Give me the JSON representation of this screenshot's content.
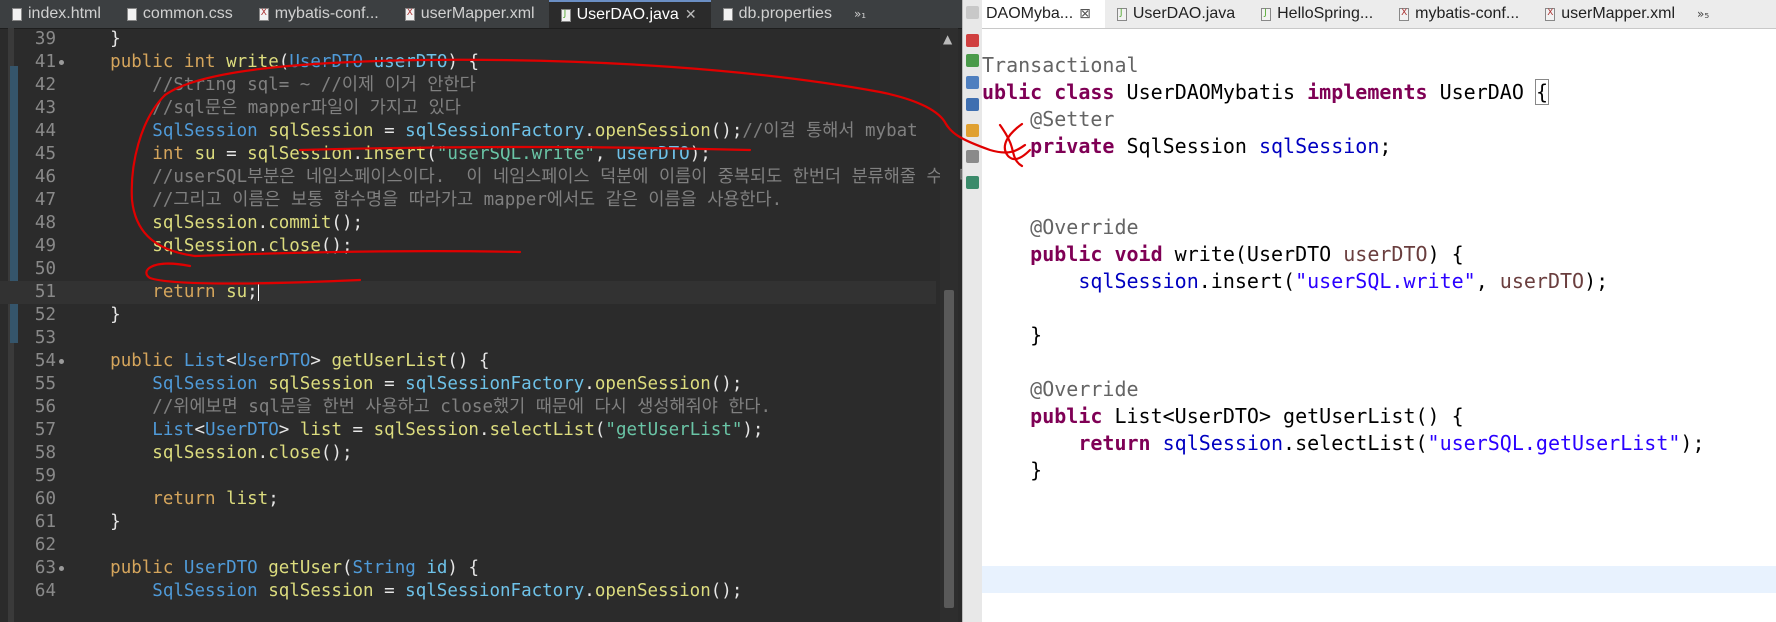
{
  "left_pane": {
    "tabs": [
      {
        "label": "index.html",
        "icon": "html-file-icon",
        "active": false
      },
      {
        "label": "common.css",
        "icon": "css-file-icon",
        "active": false
      },
      {
        "label": "mybatis-conf...",
        "icon": "xml-file-icon",
        "active": false
      },
      {
        "label": "userMapper.xml",
        "icon": "xml-file-icon",
        "active": false
      },
      {
        "label": "UserDAO.java",
        "icon": "java-file-icon",
        "active": true
      },
      {
        "label": "db.properties",
        "icon": "properties-file-icon",
        "active": false
      }
    ],
    "more_tabs": "»₁",
    "code_lines": [
      {
        "n": "39",
        "t": "    }"
      },
      {
        "n": "41",
        "t": "    public int write(UserDTO userDTO) {"
      },
      {
        "n": "42",
        "t": "        //String sql= ~ //이제 이거 안한다"
      },
      {
        "n": "43",
        "t": "        //sql문은 mapper파일이 가지고 있다"
      },
      {
        "n": "44",
        "t": "        SqlSession sqlSession = sqlSessionFactory.openSession();//이걸 통해서 mybat"
      },
      {
        "n": "45",
        "t": "        int su = sqlSession.insert(\"userSQL.write\", userDTO);"
      },
      {
        "n": "46",
        "t": "        //userSQL부분은 네임스페이스이다.  이 네임스페이스 덕분에 이름이 중복되도 한번더 분류해줄 수있다."
      },
      {
        "n": "47",
        "t": "        //그리고 이름은 보통 함수명을 따라가고 mapper에서도 같은 이름을 사용한다."
      },
      {
        "n": "48",
        "t": "        sqlSession.commit();"
      },
      {
        "n": "49",
        "t": "        sqlSession.close();"
      },
      {
        "n": "50",
        "t": ""
      },
      {
        "n": "51",
        "t": "        return su;"
      },
      {
        "n": "52",
        "t": "    }"
      },
      {
        "n": "53",
        "t": ""
      },
      {
        "n": "54",
        "t": "    public List<UserDTO> getUserList() {"
      },
      {
        "n": "55",
        "t": "        SqlSession sqlSession = sqlSessionFactory.openSession();"
      },
      {
        "n": "56",
        "t": "        //위에보면 sql문을 한번 사용하고 close했기 때문에 다시 생성해줘야 한다."
      },
      {
        "n": "57",
        "t": "        List<UserDTO> list = sqlSession.selectList(\"getUserList\");"
      },
      {
        "n": "58",
        "t": "        sqlSession.close();"
      },
      {
        "n": "59",
        "t": ""
      },
      {
        "n": "60",
        "t": "        return list;"
      },
      {
        "n": "61",
        "t": "    }"
      },
      {
        "n": "62",
        "t": ""
      },
      {
        "n": "63",
        "t": "    public UserDTO getUser(String id) {"
      },
      {
        "n": "64",
        "t": "        SqlSession sqlSession = sqlSessionFactory.openSession();"
      }
    ]
  },
  "right_pane": {
    "tabs": [
      {
        "label": "DAOMyba...",
        "icon": "java-file-icon",
        "active": true,
        "close": "⊠"
      },
      {
        "label": "UserDAO.java",
        "icon": "java-file-icon",
        "active": false
      },
      {
        "label": "HelloSpring...",
        "icon": "java-file-icon",
        "active": false
      },
      {
        "label": "mybatis-conf...",
        "icon": "xml-file-icon",
        "active": false
      },
      {
        "label": "userMapper.xml",
        "icon": "xml-file-icon",
        "active": false
      }
    ],
    "more_tabs": "»₅",
    "code_lines": [
      "Transactional",
      "ublic class UserDAOMybatis implements UserDAO {",
      "    @Setter",
      "    private SqlSession sqlSession;",
      "",
      "",
      "    @Override",
      "    public void write(UserDTO userDTO) {",
      "        sqlSession.insert(\"userSQL.write\", userDTO);",
      "",
      "    }",
      "",
      "    @Override",
      "    public List<UserDTO> getUserList() {",
      "        return sqlSession.selectList(\"userSQL.getUserList\");",
      "    }"
    ]
  },
  "colors": {
    "dark_bg": "#2b2b2b",
    "keyword": "#d5a55c",
    "type": "#4f9ad8",
    "annotation_ink": "#e00000",
    "light_keyword": "#7f0055"
  }
}
